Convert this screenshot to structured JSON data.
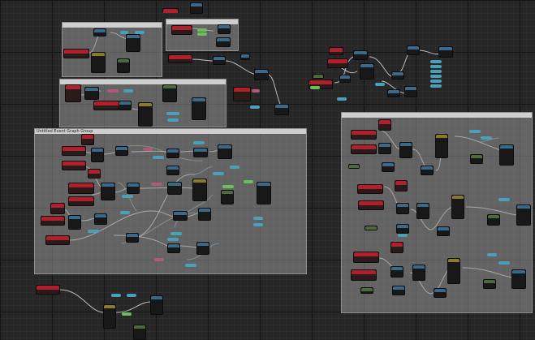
{
  "editor": {
    "accent": "#b0202c",
    "function_color": "#3a6a8a",
    "variable_color": "#4aa0b8",
    "exec_wire_color": "#d8d8d8"
  },
  "comments": [
    {
      "id": "c1",
      "title": ""
    },
    {
      "id": "c2",
      "title": ""
    },
    {
      "id": "c3",
      "title": ""
    },
    {
      "id": "c4",
      "title": "Untitled Event Graph Group"
    },
    {
      "id": "c5",
      "title": ""
    }
  ]
}
